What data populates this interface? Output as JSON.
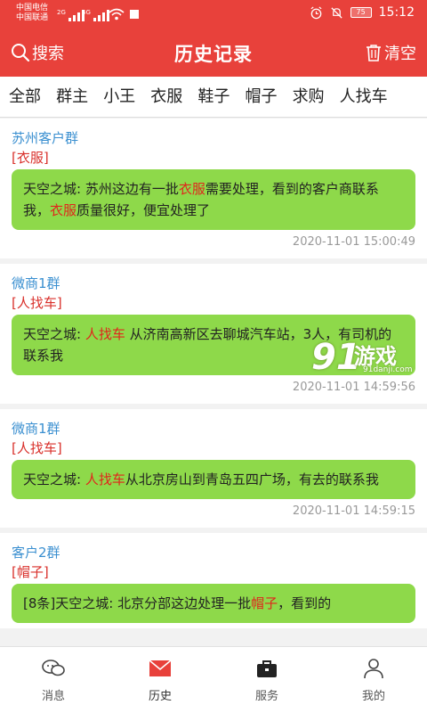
{
  "status": {
    "carrier1": "中国电信",
    "carrier2": "中国联通",
    "net1": "2G",
    "net2": "4G",
    "battery": "75",
    "time": "15:12"
  },
  "header": {
    "search_label": "搜索",
    "title": "历史记录",
    "clear_label": "清空"
  },
  "tabs": [
    "全部",
    "群主",
    "小王",
    "衣服",
    "鞋子",
    "帽子",
    "求购",
    "人找车"
  ],
  "messages": [
    {
      "group": "苏州客户群",
      "category": "[衣服]",
      "parts": [
        "天空之城: 苏州这边有一批",
        "衣服",
        "需要处理，看到的客户商联系我，",
        "衣服",
        "质量很好，便宜处理了"
      ],
      "time": "2020-11-01 15:00:49"
    },
    {
      "group": "微商1群",
      "category": "[人找车]",
      "parts": [
        "天空之城: ",
        "人找车",
        " 从济南高新区去聊城汽车站，3人，有司机的联系我"
      ],
      "time": "2020-11-01 14:59:56"
    },
    {
      "group": "微商1群",
      "category": "[人找车]",
      "parts": [
        "天空之城: ",
        "人找车",
        "从北京房山到青岛五四广场，有去的联系我"
      ],
      "time": "2020-11-01 14:59:15"
    },
    {
      "group": "客户2群",
      "category": "[帽子]",
      "parts": [
        "[8条]天空之城: 北京分部这边处理一批",
        "帽子",
        "，看到的"
      ],
      "time": ""
    }
  ],
  "watermark": {
    "big": "91",
    "text": "游戏",
    "sub": "91danji.com"
  },
  "nav": [
    {
      "label": "消息",
      "icon": "chat-icon"
    },
    {
      "label": "历史",
      "icon": "mail-icon"
    },
    {
      "label": "服务",
      "icon": "briefcase-icon"
    },
    {
      "label": "我的",
      "icon": "user-icon"
    }
  ],
  "colors": {
    "brand": "#e8413b",
    "bubble": "#8ed94a",
    "group": "#3a8fd0",
    "highlight": "#e0261c"
  }
}
